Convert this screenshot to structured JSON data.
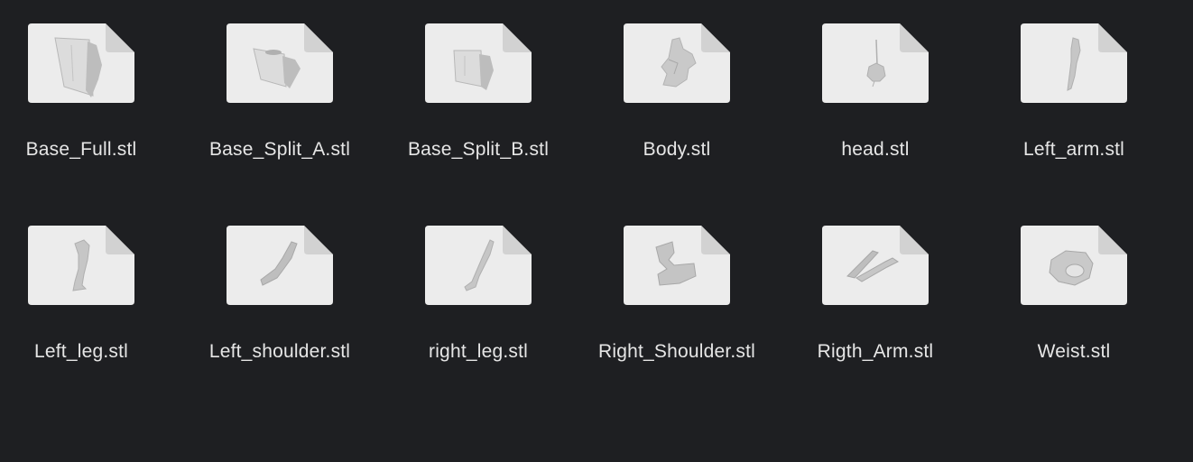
{
  "files": [
    {
      "name": "Base_Full.stl",
      "icon": "stl-file-icon"
    },
    {
      "name": "Base_Split_A.stl",
      "icon": "stl-file-icon"
    },
    {
      "name": "Base_Split_B.stl",
      "icon": "stl-file-icon"
    },
    {
      "name": "Body.stl",
      "icon": "stl-file-icon"
    },
    {
      "name": "head.stl",
      "icon": "stl-file-icon"
    },
    {
      "name": "Left_arm.stl",
      "icon": "stl-file-icon"
    },
    {
      "name": "Left_leg.stl",
      "icon": "stl-file-icon"
    },
    {
      "name": "Left_shoulder.stl",
      "icon": "stl-file-icon"
    },
    {
      "name": "right_leg.stl",
      "icon": "stl-file-icon"
    },
    {
      "name": "Right_Shoulder.stl",
      "icon": "stl-file-icon"
    },
    {
      "name": "Rigth_Arm.stl",
      "icon": "stl-file-icon"
    },
    {
      "name": "Weist.stl",
      "icon": "stl-file-icon"
    }
  ],
  "colors": {
    "background": "#1e1f22",
    "label": "#e6e6e6",
    "document": "#ececec",
    "model": "#c9c9c9"
  }
}
